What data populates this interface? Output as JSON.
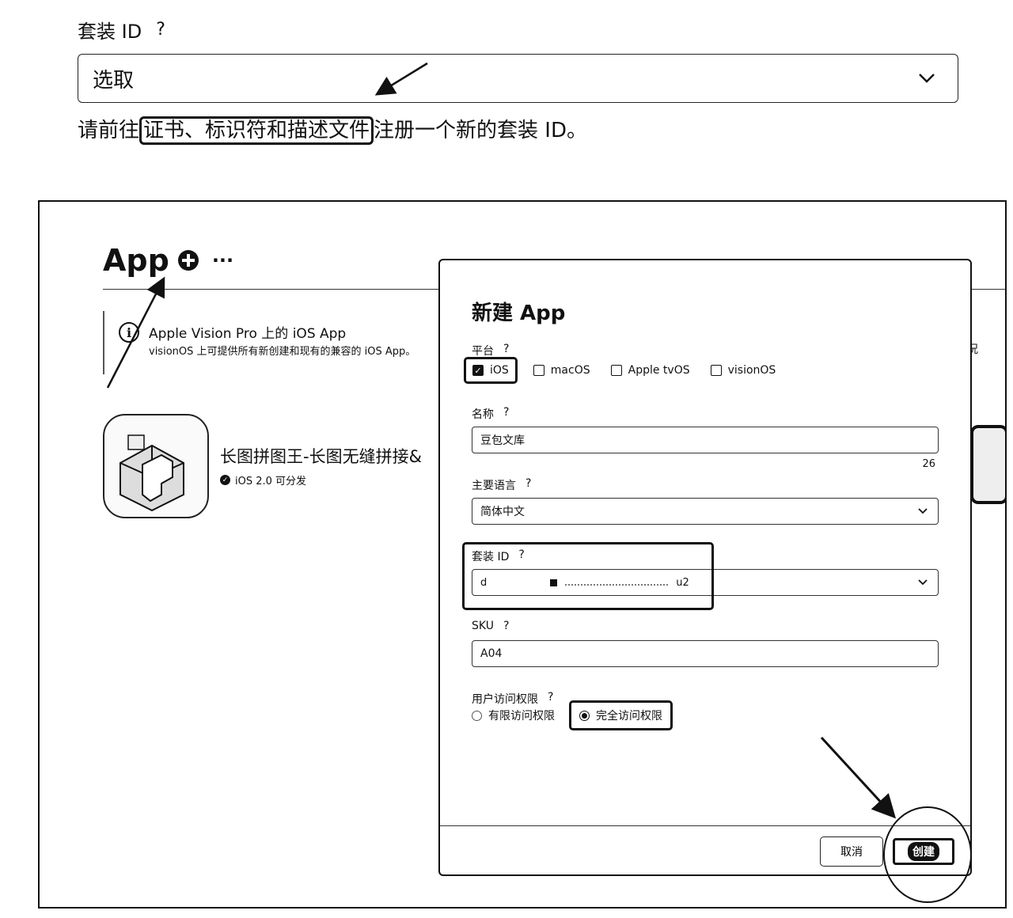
{
  "top": {
    "label": "套装 ID",
    "help": "?",
    "select_value": "选取",
    "hint_before": "请前往",
    "hint_link": "证书、标识符和描述文件",
    "hint_after": "注册一个新的套装 ID。"
  },
  "apps_page": {
    "title": "App",
    "more": "···",
    "banner_title": "Apple Vision Pro 上的 iOS App",
    "banner_text": "visionOS 上可提供所有新创建和现有的兼容的 iOS App。",
    "right_edge_text": "况",
    "app_name": "长图拼图王-长图无缝拼接&",
    "app_status": "iOS 2.0 可分发"
  },
  "dialog": {
    "title": "新建 App",
    "platform_label": "平台",
    "platforms": [
      {
        "label": "iOS",
        "checked": true
      },
      {
        "label": "macOS",
        "checked": false
      },
      {
        "label": "Apple tvOS",
        "checked": false
      },
      {
        "label": "visionOS",
        "checked": false
      }
    ],
    "name_label": "名称",
    "name_value": "豆包文库",
    "name_counter": "26",
    "language_label": "主要语言",
    "language_value": "简体中文",
    "bundle_label": "套装 ID",
    "bundle_value_start": "d",
    "bundle_value_end": "u2",
    "sku_label": "SKU",
    "sku_value": "A04",
    "access_label": "用户访问权限",
    "access_options": [
      {
        "label": "有限访问权限",
        "selected": false
      },
      {
        "label": "完全访问权限",
        "selected": true
      }
    ],
    "help": "?",
    "cancel_label": "取消",
    "create_label": "创建"
  }
}
